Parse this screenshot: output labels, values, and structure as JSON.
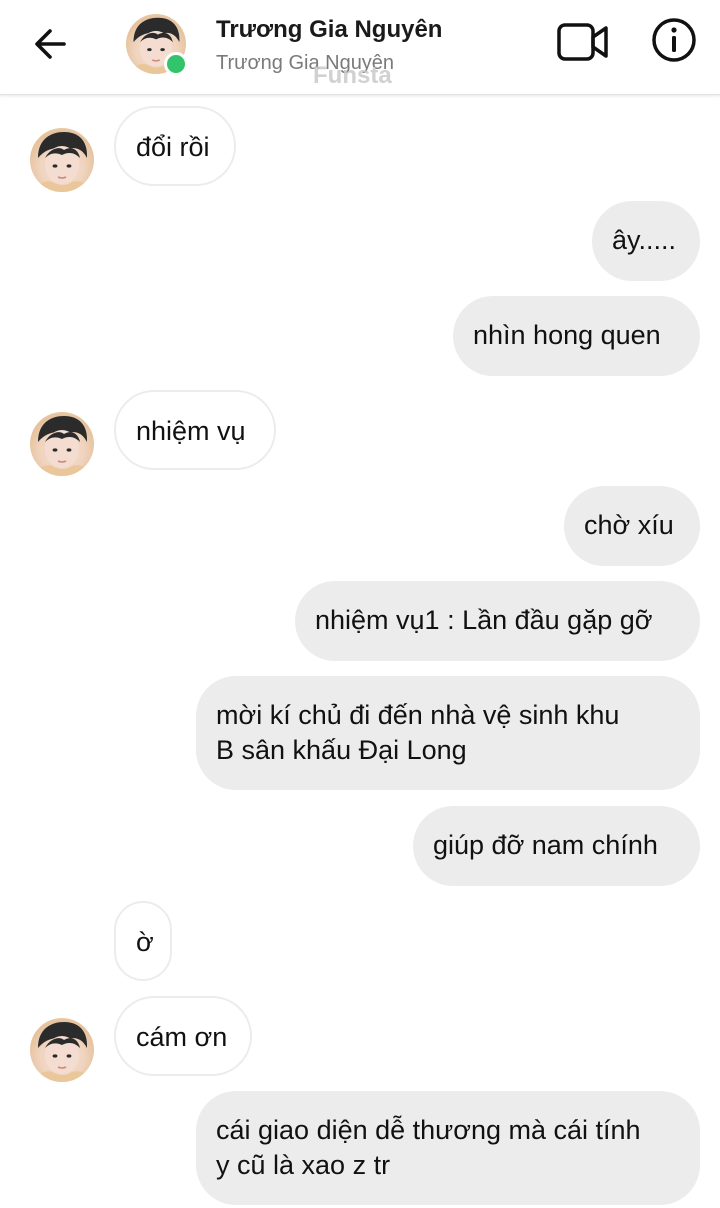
{
  "header": {
    "title": "Trương Gia Nguyên",
    "subtitle": "Trương Gia Nguyên",
    "watermark": "Funsta",
    "back_icon": "arrow-left-icon",
    "video_icon": "video-camera-icon",
    "info_icon": "info-circle-icon",
    "online": true
  },
  "colors": {
    "outgoing_bubble": "#ececec",
    "incoming_bubble": "#ffffff",
    "online_dot": "#31c46b"
  },
  "messages": [
    {
      "from": "them",
      "text": "đổi rồi"
    },
    {
      "from": "me",
      "text": "ây....."
    },
    {
      "from": "me",
      "text": "nhìn hong quen"
    },
    {
      "from": "them",
      "text": "nhiệm vụ"
    },
    {
      "from": "me",
      "text": "chờ xíu"
    },
    {
      "from": "me",
      "text": "nhiệm vụ1 : Lần đầu gặp gỡ"
    },
    {
      "from": "me",
      "text": "mời kí chủ đi đến nhà vệ sinh khu\nB sân khấu Đại Long"
    },
    {
      "from": "me",
      "text": "giúp đỡ nam chính"
    },
    {
      "from": "them",
      "text": "ờ"
    },
    {
      "from": "them",
      "text": "cám ơn"
    },
    {
      "from": "me",
      "text": "cái giao diện dễ thương mà cái tính\ny cũ là xao z tr"
    }
  ]
}
